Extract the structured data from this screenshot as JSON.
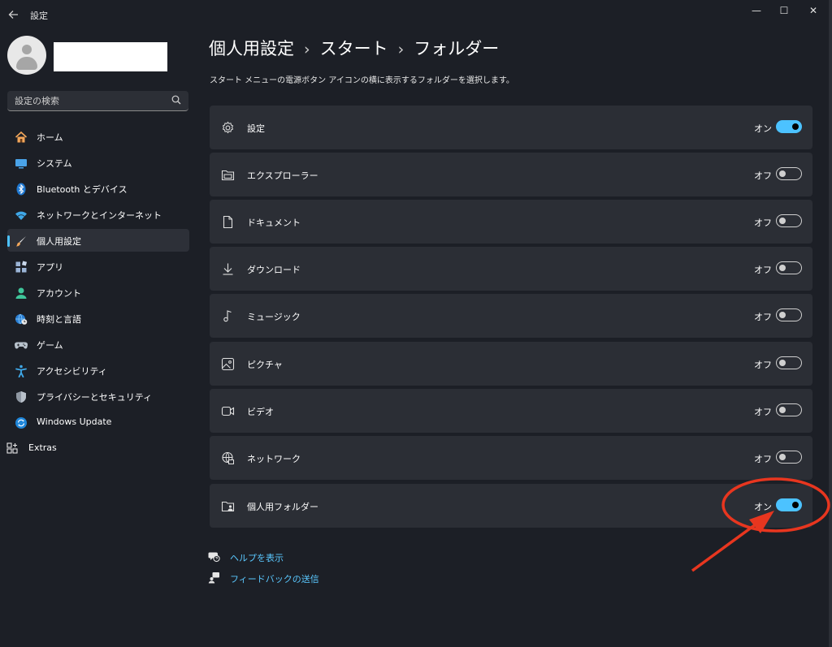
{
  "window": {
    "title": "設定",
    "minimize": "—",
    "maximize": "☐",
    "close": "✕"
  },
  "search": {
    "placeholder": "設定の検索"
  },
  "sidebar": {
    "items": [
      {
        "label": "ホーム",
        "icon": "home-icon"
      },
      {
        "label": "システム",
        "icon": "system-icon"
      },
      {
        "label": "Bluetooth とデバイス",
        "icon": "bluetooth-icon"
      },
      {
        "label": "ネットワークとインターネット",
        "icon": "wifi-icon"
      },
      {
        "label": "個人用設定",
        "icon": "brush-icon",
        "selected": true
      },
      {
        "label": "アプリ",
        "icon": "apps-icon"
      },
      {
        "label": "アカウント",
        "icon": "account-icon"
      },
      {
        "label": "時刻と言語",
        "icon": "globe-clock-icon"
      },
      {
        "label": "ゲーム",
        "icon": "gamepad-icon"
      },
      {
        "label": "アクセシビリティ",
        "icon": "accessibility-icon"
      },
      {
        "label": "プライバシーとセキュリティ",
        "icon": "shield-icon"
      },
      {
        "label": "Windows Update",
        "icon": "update-icon"
      }
    ],
    "extras": {
      "label": "Extras",
      "icon": "extras-icon"
    }
  },
  "breadcrumb": {
    "part1": "個人用設定",
    "part2": "スタート",
    "part3": "フォルダー",
    "separator": "›"
  },
  "description": "スタート メニューの電源ボタン アイコンの横に表示するフォルダーを選択します。",
  "folders": [
    {
      "label": "設定",
      "state": "オン",
      "on": true,
      "icon": "gear-icon"
    },
    {
      "label": "エクスプローラー",
      "state": "オフ",
      "on": false,
      "icon": "file-explorer-icon"
    },
    {
      "label": "ドキュメント",
      "state": "オフ",
      "on": false,
      "icon": "document-icon"
    },
    {
      "label": "ダウンロード",
      "state": "オフ",
      "on": false,
      "icon": "download-icon"
    },
    {
      "label": "ミュージック",
      "state": "オフ",
      "on": false,
      "icon": "music-icon"
    },
    {
      "label": "ピクチャ",
      "state": "オフ",
      "on": false,
      "icon": "picture-icon"
    },
    {
      "label": "ビデオ",
      "state": "オフ",
      "on": false,
      "icon": "video-icon"
    },
    {
      "label": "ネットワーク",
      "state": "オフ",
      "on": false,
      "icon": "network-icon"
    },
    {
      "label": "個人用フォルダー",
      "state": "オン",
      "on": true,
      "icon": "personal-folder-icon"
    }
  ],
  "links": {
    "help": "ヘルプを表示",
    "feedback": "フィードバックの送信"
  },
  "colors": {
    "accent": "#4cc2ff",
    "annotation": "#e8361f",
    "background": "#1c1f26",
    "card": "#2b2e35"
  }
}
